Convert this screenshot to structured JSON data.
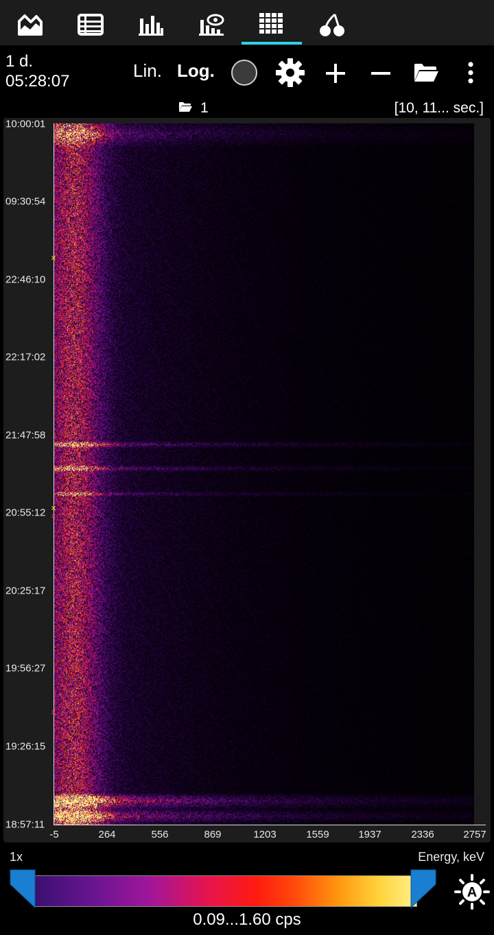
{
  "tabs": [
    {
      "icon": "chart-area-icon",
      "active": false
    },
    {
      "icon": "table-list-icon",
      "active": false
    },
    {
      "icon": "histogram-icon",
      "active": false
    },
    {
      "icon": "histogram-eye-icon",
      "active": false
    },
    {
      "icon": "grid-icon",
      "active": true
    },
    {
      "icon": "cherry-icon",
      "active": false
    }
  ],
  "toolbar": {
    "elapsed_days": "1 d.",
    "elapsed_time": "05:28:07",
    "lin_label": "Lin.",
    "log_label": "Log.",
    "record_icon": "record-circle-icon",
    "settings_icon": "gear-icon",
    "zoom_in_icon": "plus-icon",
    "zoom_out_icon": "minus-icon",
    "open_icon": "folder-open-icon",
    "menu_icon": "vertical-dots-icon"
  },
  "info": {
    "folder_count": "1",
    "interval": "[10, 11... sec.]"
  },
  "chart_data": {
    "type": "heatmap",
    "y_tick_labels": [
      "10:00:01",
      "09:30:54",
      "22:46:10",
      "22:17:02",
      "21:47:58",
      "20:55:12",
      "20:25:17",
      "19:56:27",
      "19:26:15",
      "18:57:11"
    ],
    "x_tick_labels": [
      "-5",
      "264",
      "556",
      "869",
      "1203",
      "1559",
      "1937",
      "2336",
      "2757"
    ],
    "xlabel": "Energy, keV",
    "color_range": "0.09...1.60 cps",
    "color_min": 0.09,
    "color_max": 1.6,
    "color_unit": "cps",
    "colormap": [
      "#3a1070",
      "#6c1592",
      "#a0169a",
      "#e5144f",
      "#ff1b10",
      "#ff9a10",
      "#ffd23a",
      "#fff08a"
    ]
  },
  "bottom": {
    "zoom": "1x",
    "auto_icon": "auto-brightness-icon"
  },
  "colors": {
    "accent": "#2ed3e6",
    "slider": "#1a7fd0",
    "marker_yellow": "#ffe600",
    "marker_pink": "#ff2a7a"
  }
}
